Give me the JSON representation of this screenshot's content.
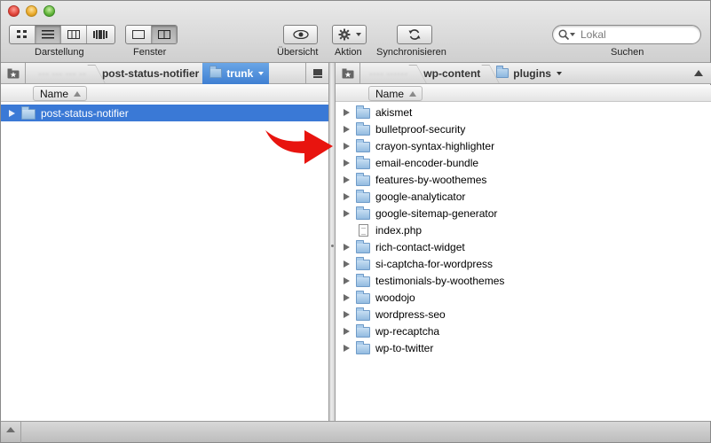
{
  "toolbar": {
    "darstellung_label": "Darstellung",
    "fenster_label": "Fenster",
    "uebersicht_label": "Übersicht",
    "aktion_label": "Aktion",
    "sync_label": "Synchronisieren",
    "search_placeholder": "Lokal",
    "search_label": "Suchen",
    "view_buttons": [
      "icon-view",
      "list-view",
      "column-view",
      "coverflow-view"
    ],
    "window_buttons": [
      "single-pane",
      "dual-pane"
    ],
    "active_view": "list-view",
    "active_window": "dual-pane"
  },
  "left": {
    "path": [
      "post-status-notifier",
      "trunk"
    ],
    "name_header": "Name",
    "items": [
      {
        "name": "post-status-notifier",
        "type": "folder",
        "selected": true
      }
    ]
  },
  "right": {
    "path": [
      "wp-content",
      "plugins"
    ],
    "name_header": "Name",
    "items": [
      {
        "name": "akismet",
        "type": "folder"
      },
      {
        "name": "bulletproof-security",
        "type": "folder"
      },
      {
        "name": "crayon-syntax-highlighter",
        "type": "folder"
      },
      {
        "name": "email-encoder-bundle",
        "type": "folder"
      },
      {
        "name": "features-by-woothemes",
        "type": "folder"
      },
      {
        "name": "google-analyticator",
        "type": "folder"
      },
      {
        "name": "google-sitemap-generator",
        "type": "folder"
      },
      {
        "name": "index.php",
        "type": "file"
      },
      {
        "name": "rich-contact-widget",
        "type": "folder"
      },
      {
        "name": "si-captcha-for-wordpress",
        "type": "folder"
      },
      {
        "name": "testimonials-by-woothemes",
        "type": "folder"
      },
      {
        "name": "woodojo",
        "type": "folder"
      },
      {
        "name": "wordpress-seo",
        "type": "folder"
      },
      {
        "name": "wp-recaptcha",
        "type": "folder"
      },
      {
        "name": "wp-to-twitter",
        "type": "folder"
      }
    ]
  },
  "colors": {
    "selection": "#3a79d6",
    "annotation_arrow": "#e8140f",
    "path_active": "#4f8fdc"
  }
}
